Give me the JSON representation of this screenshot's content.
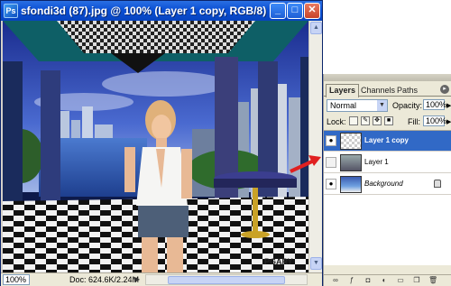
{
  "document": {
    "title": "sfondi3d (87).jpg @ 100% (Layer 1 copy, RGB/8)",
    "icon_label": "Ps",
    "minimize_label": "_",
    "maximize_label": "□",
    "close_label": "✕",
    "zoom": "100%",
    "doc_size": "Doc: 624.6K/2.24M",
    "watermark": "PGARY",
    "status_menu_arrow": "▶",
    "scroll_up": "▲",
    "scroll_down": "▼"
  },
  "layers_panel": {
    "tabs": [
      "Layers",
      "Channels",
      "Paths"
    ],
    "menu_icon": "▸",
    "blend_mode": "Normal",
    "dropdown_arrow": "▼",
    "opacity_label": "Opacity:",
    "opacity_value": "100%",
    "lock_label": "Lock:",
    "fill_label": "Fill:",
    "fill_value": "100%",
    "layers": [
      {
        "name": "Layer 1 copy",
        "visible": true,
        "selected": true
      },
      {
        "name": "Layer 1",
        "visible": false,
        "selected": false
      },
      {
        "name": "Background",
        "visible": true,
        "selected": false,
        "locked": true
      }
    ],
    "bottom_icons": [
      "link-icon",
      "fx-icon",
      "mask-icon",
      "adjustment-icon",
      "folder-icon",
      "new-layer-icon",
      "trash-icon"
    ]
  },
  "colors": {
    "titlebar": "#0a4fd4",
    "selection": "#3169c6",
    "annotation_arrow": "#e02020"
  }
}
